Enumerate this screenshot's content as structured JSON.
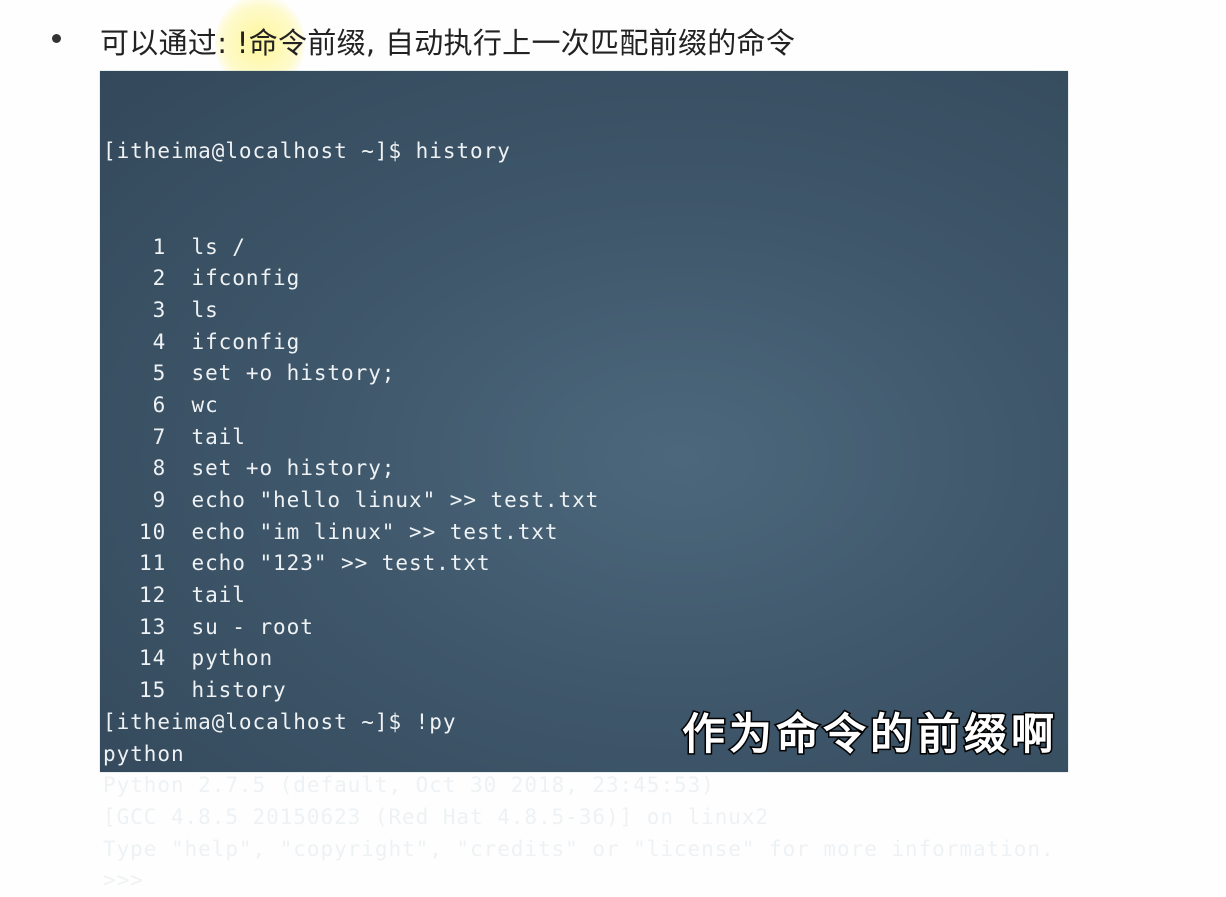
{
  "slide": {
    "heading": "可以通过: !命令前缀, 自动执行上一次匹配前缀的命令"
  },
  "terminal": {
    "prompt_history": "[itheima@localhost ~]$ history",
    "history": [
      {
        "num": "1",
        "cmd": "ls /"
      },
      {
        "num": "2",
        "cmd": "ifconfig"
      },
      {
        "num": "3",
        "cmd": "ls"
      },
      {
        "num": "4",
        "cmd": "ifconfig"
      },
      {
        "num": "5",
        "cmd": "set +o history;"
      },
      {
        "num": "6",
        "cmd": "wc"
      },
      {
        "num": "7",
        "cmd": "tail"
      },
      {
        "num": "8",
        "cmd": "set +o history;"
      },
      {
        "num": "9",
        "cmd": "echo \"hello linux\" >> test.txt"
      },
      {
        "num": "10",
        "cmd": "echo \"im linux\" >> test.txt"
      },
      {
        "num": "11",
        "cmd": "echo \"123\" >> test.txt"
      },
      {
        "num": "12",
        "cmd": "tail"
      },
      {
        "num": "13",
        "cmd": "su - root"
      },
      {
        "num": "14",
        "cmd": "python"
      },
      {
        "num": "15",
        "cmd": "history"
      }
    ],
    "output": [
      "[itheima@localhost ~]$ !py",
      "python",
      "Python 2.7.5 (default, Oct 30 2018, 23:45:53)",
      "[GCC 4.8.5 20150623 (Red Hat 4.8.5-36)] on linux2",
      "Type \"help\", \"copyright\", \"credits\" or \"license\" for more information.",
      ">>>"
    ]
  },
  "subtitle": "作为命令的前缀啊"
}
